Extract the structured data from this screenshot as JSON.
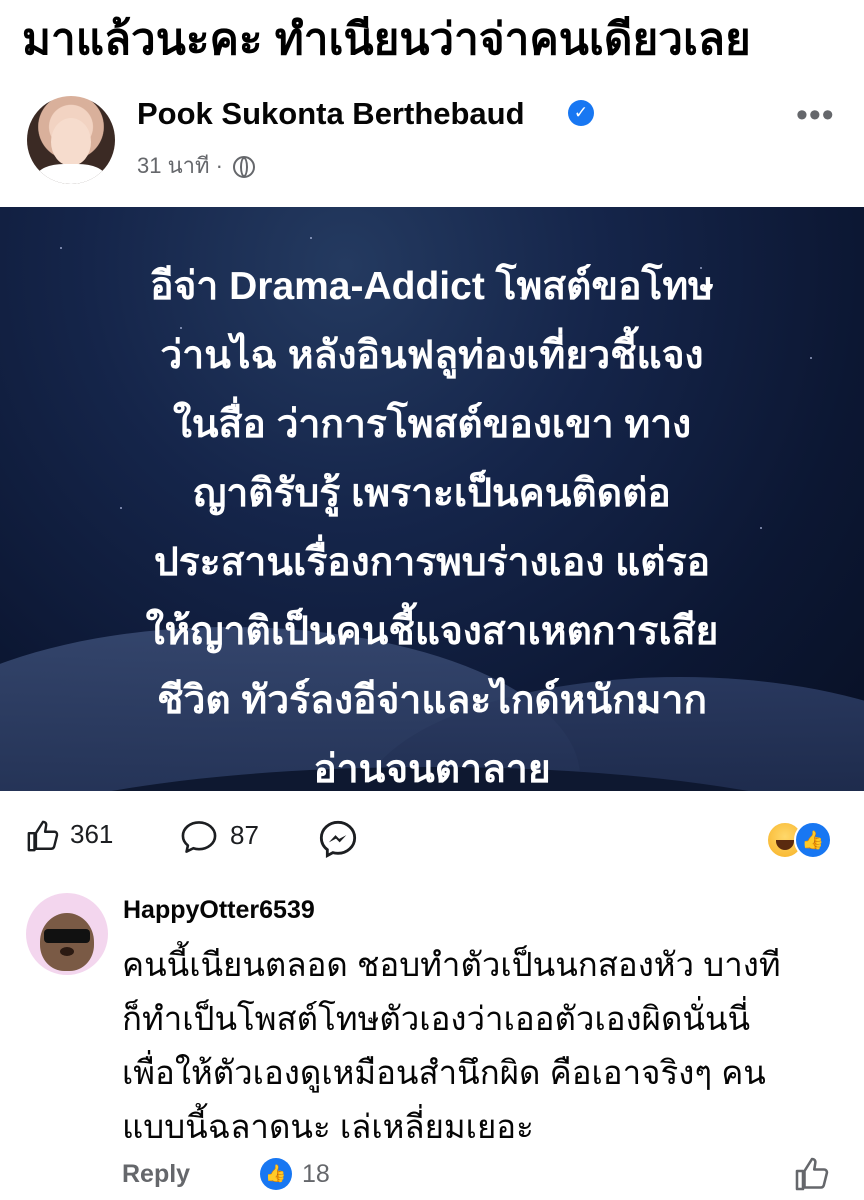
{
  "headline": "มาแล้วนะคะ ทำเนียนว่าจ่าคนเดียวเลย",
  "post": {
    "author": "Pook Sukonta Berthebaud",
    "time": "31 นาที",
    "separator": "·",
    "image_text_lines": [
      "อีจ่า Drama-Addict โพสต์ขอโทษ",
      "ว่านไฉ หลังอินฟลูท่องเที่ยวชี้แจง",
      "ในสื่อ ว่าการโพสต์ของเขา ทาง",
      "ญาติรับรู้ เพราะเป็นคนติดต่อ",
      "ประสานเรื่องการพบร่างเอง แต่รอ",
      "ให้ญาติเป็นคนชี้แจงสาเหตการเสีย",
      "ชีวิต ทัวร์ลงอีจ่าและไกด์หนักมาก",
      "อ่านจนตาลาย"
    ],
    "likes": "361",
    "comments": "87"
  },
  "comment": {
    "username": "HappyOtter6539",
    "lines": [
      "คนนี้เนียนตลอด ชอบทำตัวเป็นนกสองหัว บางที",
      "ก็ทำเป็นโพสต์โทษตัวเองว่าเออตัวเองผิดนั่นนี่",
      "เพื่อให้ตัวเองดูเหมือนสำนึกผิด คือเอาจริงๆ คน",
      "แบบนี้ฉลาดนะ เล่เหลี่ยมเยอะ"
    ],
    "reply_label": "Reply",
    "like_count": "18"
  },
  "icons": {
    "verified": "verified-badge-icon",
    "globe": "globe-icon",
    "more": "more-options-icon",
    "like": "thumbs-up-icon",
    "comment": "comment-bubble-icon",
    "share": "messenger-icon",
    "reactions": [
      "haha-reaction-icon",
      "like-reaction-icon"
    ]
  },
  "colors": {
    "accent": "#1877f2",
    "muted": "#65676b",
    "image_bg": "#0c1733"
  }
}
